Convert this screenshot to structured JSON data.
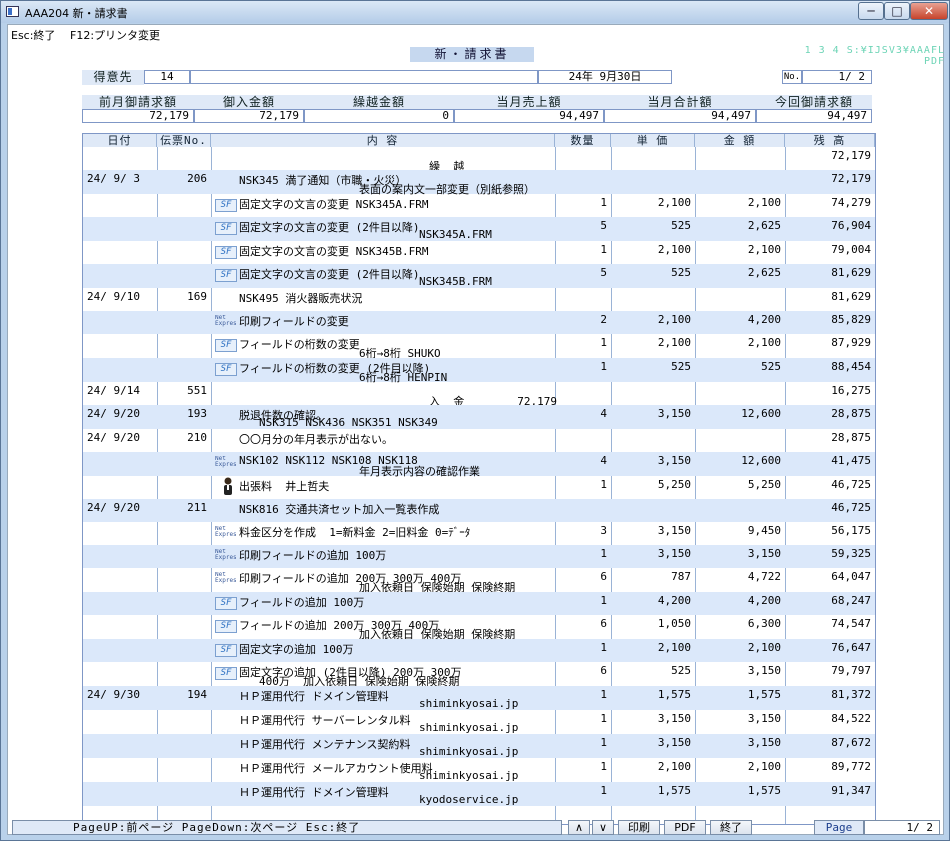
{
  "window": {
    "title": "AAA204 新・請求書",
    "min": "─",
    "max": "□",
    "close": "✕"
  },
  "menu": {
    "esc": "Esc:終了",
    "f12": "F12:プリンタ変更"
  },
  "doc": {
    "title": "新・請求書",
    "topright": "1 3 4 S:¥IJSV3¥AAAFL",
    "topright2": "PDF"
  },
  "customer": {
    "label": "得意先",
    "code": "14",
    "name": "",
    "date": "24年 9月30日",
    "no_label": "No.",
    "page": "1/  2"
  },
  "summary": {
    "labels": [
      "前月御請求額",
      "御入金額",
      "繰越金額",
      "当月売上額",
      "当月合計額",
      "今回御請求額"
    ],
    "values": [
      "72,179",
      "72,179",
      "0",
      "94,497",
      "94,497",
      "94,497"
    ]
  },
  "table": {
    "headers": [
      "日付",
      "伝票No.",
      "内            容",
      "数量",
      "単 価",
      "金 額",
      "残  高"
    ]
  },
  "rows": [
    {
      "date": "",
      "slip": "",
      "icon": "",
      "desc": "",
      "desc2": "繰  越",
      "qty": "",
      "price": "",
      "amt": "",
      "bal": "72,179"
    },
    {
      "date": "24/ 9/ 3",
      "slip": "206",
      "icon": "",
      "desc": "NSK345 満了通知（市職・火災）",
      "desc2": "表面の案内文一部変更（別紙参照）",
      "qty": "",
      "price": "",
      "amt": "",
      "bal": "72,179"
    },
    {
      "date": "",
      "slip": "",
      "icon": "sf",
      "desc": "固定文字の文言の変更 NSK345A.FRM",
      "desc2": "",
      "qty": "1",
      "price": "2,100",
      "amt": "2,100",
      "bal": "74,279"
    },
    {
      "date": "",
      "slip": "",
      "icon": "sf",
      "desc": "固定文字の文言の変更 (2件目以降)",
      "desc2": "NSK345A.FRM",
      "qty": "5",
      "price": "525",
      "amt": "2,625",
      "bal": "76,904"
    },
    {
      "date": "",
      "slip": "",
      "icon": "sf",
      "desc": "固定文字の文言の変更 NSK345B.FRM",
      "desc2": "",
      "qty": "1",
      "price": "2,100",
      "amt": "2,100",
      "bal": "79,004"
    },
    {
      "date": "",
      "slip": "",
      "icon": "sf",
      "desc": "固定文字の文言の変更 (2件目以降)",
      "desc2": "NSK345B.FRM",
      "qty": "5",
      "price": "525",
      "amt": "2,625",
      "bal": "81,629"
    },
    {
      "date": "24/ 9/10",
      "slip": "169",
      "icon": "",
      "desc": "NSK495 消火器販売状況",
      "desc2": "",
      "qty": "",
      "price": "",
      "amt": "",
      "bal": "81,629"
    },
    {
      "date": "",
      "slip": "",
      "icon": "ne",
      "desc": "印刷フィールドの変更",
      "desc2": "",
      "qty": "2",
      "price": "2,100",
      "amt": "4,200",
      "bal": "85,829"
    },
    {
      "date": "",
      "slip": "",
      "icon": "sf",
      "desc": "フィールドの桁数の変更",
      "desc2": "6桁→8桁 SHUKO",
      "qty": "1",
      "price": "2,100",
      "amt": "2,100",
      "bal": "87,929"
    },
    {
      "date": "",
      "slip": "",
      "icon": "sf",
      "desc": "フィールドの桁数の変更 (2件目以降)",
      "desc2": "6桁→8桁 HENPIN",
      "qty": "1",
      "price": "525",
      "amt": "525",
      "bal": "88,454"
    },
    {
      "date": "24/ 9/14",
      "slip": "551",
      "icon": "",
      "desc": "",
      "desc2": "入  金        72,179",
      "qty": "",
      "price": "",
      "amt": "",
      "bal": "16,275"
    },
    {
      "date": "24/ 9/20",
      "slip": "193",
      "icon": "",
      "desc": "脱退件数の確認。",
      "desc2": "NSK315 NSK436 NSK351 NSK349",
      "qty": "4",
      "price": "3,150",
      "amt": "12,600",
      "bal": "28,875"
    },
    {
      "date": "24/ 9/20",
      "slip": "210",
      "icon": "",
      "desc": "〇〇月分の年月表示が出ない。",
      "desc2": "",
      "qty": "",
      "price": "",
      "amt": "",
      "bal": "28,875"
    },
    {
      "date": "",
      "slip": "",
      "icon": "ne",
      "desc": "NSK102 NSK112 NSK108 NSK118",
      "desc2": "年月表示内容の確認作業",
      "qty": "4",
      "price": "3,150",
      "amt": "12,600",
      "bal": "41,475"
    },
    {
      "date": "",
      "slip": "",
      "icon": "pp",
      "desc": "出張料  井上哲夫",
      "desc2": "",
      "qty": "1",
      "price": "5,250",
      "amt": "5,250",
      "bal": "46,725"
    },
    {
      "date": "24/ 9/20",
      "slip": "211",
      "icon": "",
      "desc": "NSK816 交通共済セット加入一覧表作成",
      "desc2": "",
      "qty": "",
      "price": "",
      "amt": "",
      "bal": "46,725"
    },
    {
      "date": "",
      "slip": "",
      "icon": "ne",
      "desc": "料金区分を作成  1=新料金 2=旧料金 0=ﾃﾞｰﾀ",
      "desc2": "",
      "qty": "3",
      "price": "3,150",
      "amt": "9,450",
      "bal": "56,175"
    },
    {
      "date": "",
      "slip": "",
      "icon": "ne",
      "desc": "印刷フィールドの追加 100万",
      "desc2": "",
      "qty": "1",
      "price": "3,150",
      "amt": "3,150",
      "bal": "59,325"
    },
    {
      "date": "",
      "slip": "",
      "icon": "ne",
      "desc": "印刷フィールドの追加 200万 300万 400万",
      "desc2": "加入依頼日 保険始期 保険終期",
      "qty": "6",
      "price": "787",
      "amt": "4,722",
      "bal": "64,047"
    },
    {
      "date": "",
      "slip": "",
      "icon": "sf",
      "desc": "フィールドの追加 100万",
      "desc2": "",
      "qty": "1",
      "price": "4,200",
      "amt": "4,200",
      "bal": "68,247"
    },
    {
      "date": "",
      "slip": "",
      "icon": "sf",
      "desc": "フィールドの追加 200万 300万 400万",
      "desc2": "加入依頼日 保険始期 保険終期",
      "qty": "6",
      "price": "1,050",
      "amt": "6,300",
      "bal": "74,547"
    },
    {
      "date": "",
      "slip": "",
      "icon": "sf",
      "desc": "固定文字の追加 100万",
      "desc2": "",
      "qty": "1",
      "price": "2,100",
      "amt": "2,100",
      "bal": "76,647"
    },
    {
      "date": "",
      "slip": "",
      "icon": "sf",
      "desc": "固定文字の追加 (2件目以降) 200万 300万",
      "desc2": "400万  加入依頼日 保険始期 保険終期",
      "qty": "6",
      "price": "525",
      "amt": "3,150",
      "bal": "79,797"
    },
    {
      "date": "24/ 9/30",
      "slip": "194",
      "icon": "",
      "desc": "ＨＰ運用代行 ドメイン管理料",
      "desc2": "shiminkyosai.jp",
      "qty": "1",
      "price": "1,575",
      "amt": "1,575",
      "bal": "81,372"
    },
    {
      "date": "",
      "slip": "",
      "icon": "",
      "desc": "ＨＰ運用代行 サーバーレンタル料",
      "desc2": "shiminkyosai.jp",
      "qty": "1",
      "price": "3,150",
      "amt": "3,150",
      "bal": "84,522"
    },
    {
      "date": "",
      "slip": "",
      "icon": "",
      "desc": "ＨＰ運用代行 メンテナンス契約料",
      "desc2": "shiminkyosai.jp",
      "qty": "1",
      "price": "3,150",
      "amt": "3,150",
      "bal": "87,672"
    },
    {
      "date": "",
      "slip": "",
      "icon": "",
      "desc": "ＨＰ運用代行 メールアカウント使用料",
      "desc2": "shiminkyosai.jp",
      "qty": "1",
      "price": "2,100",
      "amt": "2,100",
      "bal": "89,772"
    },
    {
      "date": "",
      "slip": "",
      "icon": "",
      "desc": "ＨＰ運用代行 ドメイン管理料",
      "desc2": "kyodoservice.jp",
      "qty": "1",
      "price": "1,575",
      "amt": "1,575",
      "bal": "91,347"
    }
  ],
  "icons": {
    "sf": "SF",
    "ne_line1": "Net",
    "ne_line2": "Express",
    "pp": "person-icon"
  },
  "footer": {
    "hint": "PageUP:前ページ  PageDown:次ページ   Esc:終了",
    "up": "∧",
    "down": "∨",
    "print": "印刷",
    "pdf": "PDF",
    "quit": "終了",
    "page_label": "Page",
    "page": "1/  2"
  }
}
